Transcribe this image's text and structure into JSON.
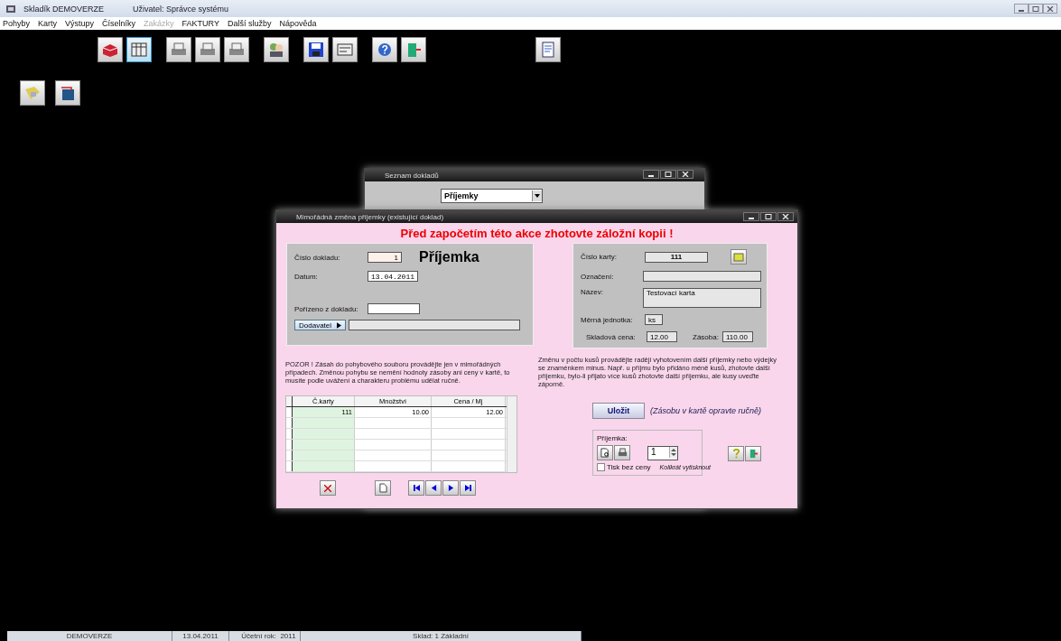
{
  "title_bar": {
    "app": "Skladík DEMOVERZE",
    "user": "Uživatel: Správce systému"
  },
  "menu": [
    {
      "label": "Pohyby",
      "disabled": false
    },
    {
      "label": "Karty",
      "disabled": false
    },
    {
      "label": "Výstupy",
      "disabled": false
    },
    {
      "label": "Číselníky",
      "disabled": false
    },
    {
      "label": "Zakázky",
      "disabled": true
    },
    {
      "label": "FAKTURY",
      "disabled": false
    },
    {
      "label": "Další služby",
      "disabled": false
    },
    {
      "label": "Nápověda",
      "disabled": false
    }
  ],
  "back_window": {
    "title": "Seznam dokladů",
    "dropdown_value": "Příjemky"
  },
  "dialog": {
    "title": "Mimořádná změna příjemky (existující doklad)",
    "warning": "Před započetím této akce zhotovte záložní kopii !",
    "doc_number_label": "Číslo dokladu:",
    "doc_number": "1",
    "doc_type": "Příjemka",
    "date_label": "Datum:",
    "date": "13.04.2011",
    "source_label": "Pořízeno z dokladu:",
    "supplier_button": "Dodavatel",
    "card_number_label": "Číslo karty:",
    "card_number": "111",
    "designation_label": "Označení:",
    "name_label": "Název:",
    "name": "Testovací karta",
    "unit_label": "Měrná jednotka:",
    "unit": "ks",
    "price_label": "Skladová cena:",
    "price": "12.00",
    "stock_label": "Zásoba:",
    "stock": "110.00",
    "note_left": "POZOR !  Zásah do pohybového souboru provádějte jen v mimořádných případech. Změnou pohybu se nemění hodnoty zásoby ani ceny v kartě, to musíte podle uvážení  a charakteru problému udělat ručně.",
    "note_right": "Změnu v počtu kusů provádějte raději vyhotovením další příjemky nebo výdejky se znaménkem minus. Např. u příjmu bylo přidáno méně kusů, zhotovte další příjemku, bylo-li přijato více kusů zhotovte další příjemku, ale kusy uveďte záporně.",
    "table": {
      "columns": [
        "Č.karty",
        "Množství",
        "Cena / Mj"
      ],
      "rows": [
        [
          "111",
          "10.00",
          "12.00"
        ]
      ]
    },
    "save_button": "Uložit",
    "save_note": "(Zásobu v kartě opravte ručně)",
    "print_label": "Příjemka:",
    "copies": "1",
    "no_price_label": "Tisk bez ceny",
    "no_price_checked": false,
    "copies_label": "Kolikrát vytisknout"
  },
  "status_bar": [
    {
      "text": "DEMOVERZE",
      "kind": "wide"
    },
    {
      "text": "13.04.2011",
      "kind": "date"
    },
    {
      "text": "Účetní rok:",
      "kind": "label"
    },
    {
      "text": "2011",
      "kind": "year"
    },
    {
      "text": "Sklad: 1 Základní",
      "kind": "store"
    }
  ]
}
